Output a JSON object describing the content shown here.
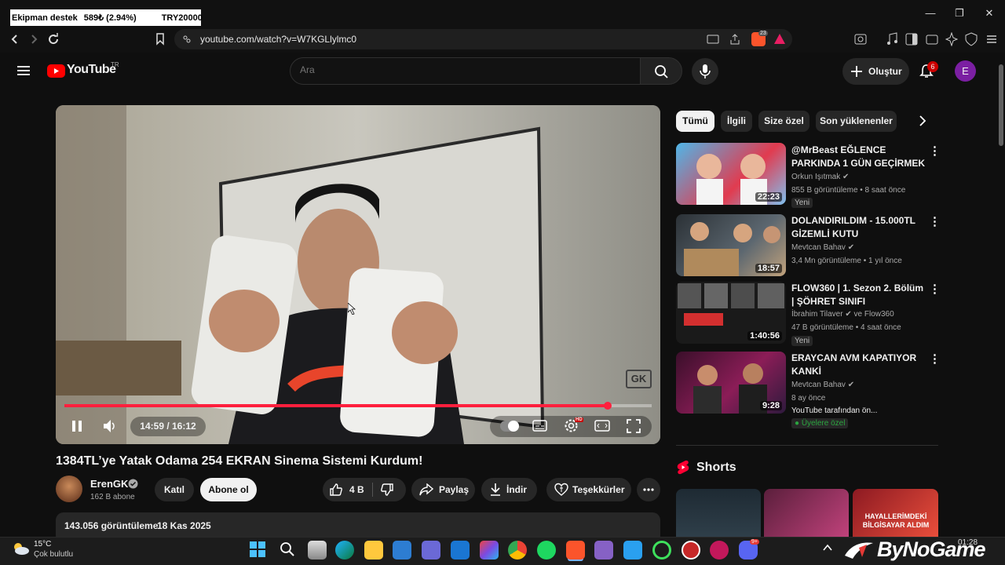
{
  "ticker": {
    "text1": "Ekipman destek",
    "text2": "589₺ (2.94%)",
    "text3": "TRY20000"
  },
  "browser": {
    "url": "youtube.com/watch?v=W7KGLlylmc0",
    "brave_badge": "23"
  },
  "header": {
    "logo": "YouTube",
    "region": "TR",
    "search_placeholder": "Ara",
    "create_label": "Oluştur",
    "notif_count": "6",
    "avatar_letter": "E"
  },
  "player": {
    "time": "14:59 / 16:12",
    "progress": 0.925,
    "hd_badge": "HD",
    "watermark": "GK"
  },
  "video": {
    "title": "1384TL’ye Yatak Odama 254 EKRAN Sinema Sistemi Kurdum!",
    "channel": "ErenGK",
    "subs": "162 B abone",
    "join_label": "Katıl",
    "subscribe_label": "Abone ol",
    "likes": "4 B",
    "share_label": "Paylaş",
    "download_label": "İndir",
    "thanks_label": "Teşekkürler",
    "views": "143.056 görüntüleme",
    "date": "18 Kas 2025"
  },
  "chips": [
    "Tümü",
    "İlgili",
    "Size özel",
    "Son yüklenenler"
  ],
  "recommendations": [
    {
      "title": "@MrBeast  EĞLENCE PARKINDA 1 GÜN GEÇİRMEK",
      "channel": "Orkun Işıtmak",
      "meta": "855 B görüntüleme • 8 saat önce",
      "badge": "Yeni",
      "duration": "22:23"
    },
    {
      "title": "DOLANDIRILDIM - 15.000TL GİZEMLİ KUTU",
      "channel": "Mevtcan Bahav",
      "meta": "3,4 Mn görüntüleme • 1 yıl önce",
      "badge": "",
      "duration": "18:57"
    },
    {
      "title": "FLOW360 | 1. Sezon 2. Bölüm | ŞÖHRET SINIFI",
      "channel": "İbrahim Tilaver",
      "channel_extra": "ve Flow360",
      "meta": "47 B görüntüleme • 4 saat önce",
      "badge": "Yeni",
      "duration": "1:40:56"
    },
    {
      "title": "ERAYCAN AVM KAPATIYOR KANKİ",
      "channel": "Mevtcan Bahav",
      "meta": "8 ay önce",
      "extra": "YouTube tarafından ön...",
      "badge": "Üyelere özel",
      "duration": "9:28"
    }
  ],
  "shorts": {
    "title": "Shorts",
    "short3_text": "HAYALLERİMDEKİ BİLGİSAYAR ALDIM"
  },
  "weather": {
    "temp": "15°C",
    "desc": "Çok bulutlu"
  },
  "taskbar": {
    "clock": "01:28",
    "watermark": "ByNoGame",
    "discord_badge": "9+"
  }
}
